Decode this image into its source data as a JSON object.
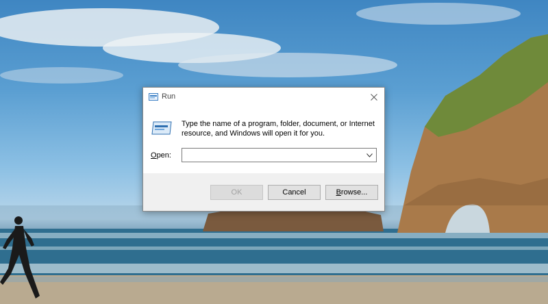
{
  "dialog": {
    "title": "Run",
    "prompt": "Type the name of a program, folder, document, or Internet resource, and Windows will open it for you.",
    "open_label_mnemonic": "O",
    "open_label_rest": "pen:",
    "input_value": "",
    "buttons": {
      "ok": "OK",
      "cancel": "Cancel",
      "browse_mnemonic": "B",
      "browse_rest": "rowse..."
    }
  },
  "colors": {
    "dialog_bg": "#ffffff",
    "footer_bg": "#f0f0f0",
    "button_bg": "#e1e1e1",
    "disabled_text": "#a0a0a0"
  },
  "icons": [
    "run-icon",
    "close-icon",
    "chevron-down-icon"
  ]
}
